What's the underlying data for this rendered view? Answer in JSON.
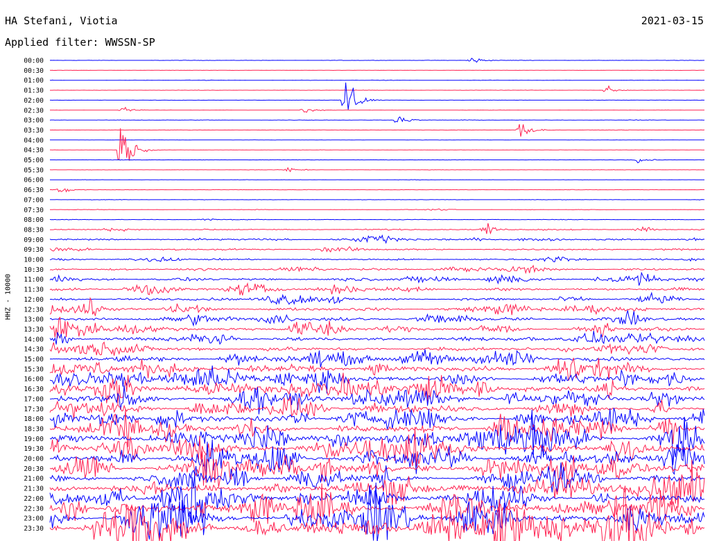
{
  "header": {
    "station": "HA Stefani, Viotia",
    "date": "2021-03-15",
    "filter": "Applied filter: WWSSN-SP"
  },
  "chart_data": {
    "type": "line",
    "title": "HA Stefani, Viotia",
    "subtitle": "Applied filter: WWSSN-SP",
    "date": "2021-03-15",
    "ylabel": "HHZ - 10000",
    "xlabel": "",
    "row_labels": [
      "00:00",
      "00:30",
      "01:00",
      "01:30",
      "02:00",
      "02:30",
      "03:00",
      "03:30",
      "04:00",
      "04:30",
      "05:00",
      "05:30",
      "06:00",
      "06:30",
      "07:00",
      "07:30",
      "08:00",
      "08:30",
      "09:00",
      "09:30",
      "10:00",
      "10:30",
      "11:00",
      "11:30",
      "12:00",
      "12:30",
      "13:00",
      "13:30",
      "14:00",
      "14:30",
      "15:00",
      "15:30",
      "16:00",
      "16:30",
      "17:00",
      "17:30",
      "18:00",
      "18:30",
      "19:00",
      "19:30",
      "20:00",
      "20:30",
      "21:00",
      "21:30",
      "22:00",
      "22:30",
      "23:00",
      "23:30"
    ],
    "colors": [
      "#0000ff",
      "#ff2050"
    ],
    "trace_minutes": 30,
    "noise_level": [
      0.25,
      0.2,
      0.3,
      0.25,
      0.2,
      0.25,
      0.3,
      0.25,
      0.2,
      0.2,
      0.25,
      0.25,
      0.25,
      0.3,
      0.3,
      0.35,
      0.5,
      0.9,
      1.6,
      1.3,
      1.1,
      1.5,
      2.0,
      2.1,
      1.9,
      2.3,
      2.6,
      3.0,
      2.6,
      2.7,
      2.9,
      3.6,
      4.4,
      4.6,
      4.1,
      4.0,
      4.6,
      5.0,
      5.3,
      5.2,
      4.9,
      4.8,
      4.3,
      4.5,
      5.0,
      5.2,
      6.0,
      6.8
    ],
    "events": [
      {
        "row": 0,
        "minute": 19.2,
        "amplitude": 8
      },
      {
        "row": 3,
        "minute": 25.5,
        "amplitude": 6
      },
      {
        "row": 5,
        "minute": 3.2,
        "amplitude": 6
      },
      {
        "row": 5,
        "minute": 11.6,
        "amplitude": 4
      },
      {
        "row": 4,
        "minute": 13.5,
        "amplitude": 55
      },
      {
        "row": 6,
        "minute": 15.9,
        "amplitude": 9
      },
      {
        "row": 7,
        "minute": 21.5,
        "amplitude": 14
      },
      {
        "row": 10,
        "minute": 26.9,
        "amplitude": 5
      },
      {
        "row": 11,
        "minute": 10.8,
        "amplitude": 7
      },
      {
        "row": 13,
        "minute": 0.4,
        "amplitude": 7
      },
      {
        "row": 9,
        "minute": 3.2,
        "amplitude": 48
      },
      {
        "row": 17,
        "minute": 19.8,
        "amplitude": 12
      }
    ]
  }
}
